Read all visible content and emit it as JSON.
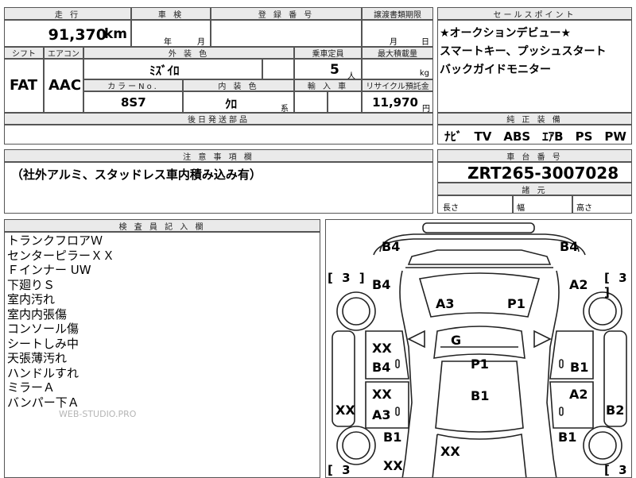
{
  "headers": {
    "mileage": "走 行",
    "shaken": "車 検",
    "reg_no": "登 録 番 号",
    "transfer_deadline": "譲渡書類期限",
    "sales_point": "セールスポイント",
    "shift": "シフト",
    "aircon": "エアコン",
    "exterior_color": "外 装 色",
    "capacity": "乗車定員",
    "max_load": "最大積載量",
    "color_no": "カラーNo.",
    "interior_color": "内 装 色",
    "import": "輸 入 車",
    "recycle": "リサイクル預託金",
    "later_parts": "後日発送部品",
    "factory_equipment": "純 正 装 備",
    "notes": "注 意 事 項 欄",
    "chassis_no": "車 台 番 号",
    "dimensions": "諸 元",
    "inspector": "検 査 員 記 入 欄"
  },
  "vehicle": {
    "mileage": "91,370",
    "mileage_unit": "km",
    "year_label": "年",
    "month_label": "月",
    "deadline_month": "月",
    "deadline_day": "日",
    "shift": "FAT",
    "aircon": "AAC",
    "exterior_color": "ﾐｽﾞｲﾛ",
    "capacity": "5",
    "capacity_unit": "人",
    "load_unit": "kg",
    "color_no": "8S7",
    "interior_color": "ｸﾛ",
    "interior_suffix": "系",
    "recycle_fee": "11,970",
    "recycle_unit": "円",
    "chassis_no": "ZRT265-3007028",
    "length_label": "長さ",
    "width_label": "幅",
    "height_label": "高さ"
  },
  "sales_points": [
    "★オークションデビュー★",
    "スマートキー、プッシュスタート",
    "バックガイドモニター"
  ],
  "equipment": "ﾅﾋﾞ　TV　ABS　ｴｱB　PS　PW",
  "notes": "（社外アルミ、スタッドレス車内積み込み有）",
  "inspector_notes": [
    "トランクフロアＷ",
    "センターピラーＸＸ",
    "Ｆインナー UW",
    "下廻りＳ",
    "室内汚れ",
    "室内内張傷",
    "コンソール傷",
    "シートしみ中",
    "天張薄汚れ",
    "ハンドルすれ",
    "ミラーＡ",
    "バンパー下Ａ"
  ],
  "watermark": "WEB-STUDIO.PRO",
  "diagram": {
    "tire_left_front": "[ 3 ]",
    "tire_right_front": "[ 3 ]",
    "tire_left_rear": "[ 3",
    "tire_right_rear": "[ 3",
    "marks": {
      "b4_top_left": "B4",
      "b4_top_right": "B4",
      "b4_left_door": "B4",
      "a2_right_fender": "A2",
      "a3_windshield": "A3",
      "p1_windshield": "P1",
      "g_roof": "G",
      "xx_left_front_door": "XX",
      "b4_left_front_door": "B4",
      "p1_roof": "P1",
      "b1_right_front_door": "B1",
      "xx_left_rear_door": "XX",
      "a3_left_rear_door": "A3",
      "b1_rear_glass": "B1",
      "a2_right_rear_door": "A2",
      "xx_left_side": "XX",
      "b2_right_side": "B2",
      "b1_left_rear_fender": "B1",
      "b1_right_rear_fender": "B1",
      "xx_trunk": "XX",
      "xx_left_bottom": "XX"
    }
  }
}
